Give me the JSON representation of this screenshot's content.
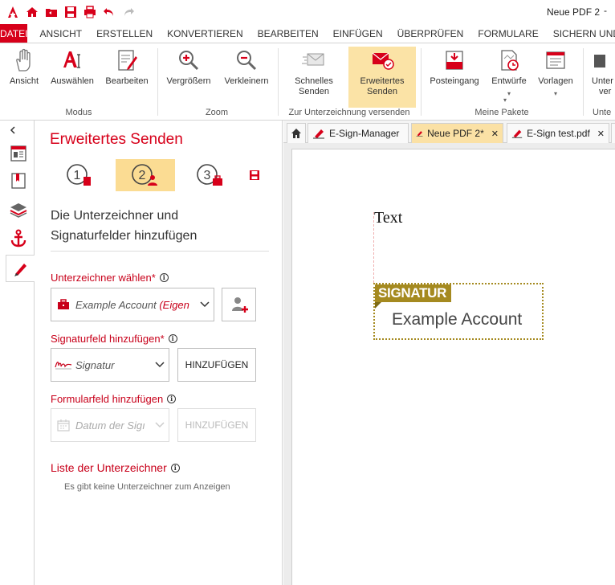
{
  "window": {
    "title": "Neue PDF 2",
    "minimize": "-"
  },
  "ribbon_tabs": [
    "DATEI",
    "ANSICHT",
    "ERSTELLEN",
    "KONVERTIEREN",
    "BEARBEITEN",
    "EINFÜGEN",
    "ÜBERPRÜFEN",
    "FORMULARE",
    "SICHERN UND UNT"
  ],
  "ribbon": {
    "buttons": {
      "ansicht": "Ansicht",
      "auswaehlen": "Auswählen",
      "bearbeiten": "Bearbeiten",
      "vergroessern": "Vergrößern",
      "verkleinern": "Verkleinern",
      "schnelles_senden_1": "Schnelles",
      "schnelles_senden_2": "Senden",
      "erweitertes_senden_1": "Erweitertes",
      "erweitertes_senden_2": "Senden",
      "posteingang": "Posteingang",
      "entwuerfe": "Entwürfe",
      "vorlagen": "Vorlagen",
      "unter_1": "Unter",
      "unter_2": "ver"
    },
    "groups": {
      "modus": "Modus",
      "zoom": "Zoom",
      "zur_unterzeichnung": "Zur Unterzeichnung versenden",
      "meine_pakete": "Meine Pakete",
      "unter": "Unte"
    },
    "dropdown_glyph": "▾"
  },
  "panel": {
    "title": "Erweitertes Senden",
    "steps": [
      "1",
      "2",
      "3"
    ],
    "heading_line1": "Die Unterzeichner und",
    "heading_line2": "Signaturfelder hinzufügen",
    "signer_label": "Unterzeichner wählen",
    "signer_value": "Example Account",
    "signer_value_suffix": "(Eigen",
    "sigfield_label": "Signaturfeld hinzufügen",
    "sigfield_value": "Signatur",
    "add_button": "HINZUFÜGEN",
    "formfield_label": "Formularfeld hinzufügen",
    "formfield_value": "Datum der Sigı",
    "add_button_disabled": "HINZUFÜGEN",
    "signer_list_title": "Liste der Unterzeichner",
    "signer_list_empty": "Es gibt keine Unterzeichner zum Anzeigen",
    "required_mark": "*",
    "info_glyph": "i"
  },
  "doc_tabs": [
    {
      "label": "E-Sign-Manager",
      "closable": false
    },
    {
      "label": "Neue PDF 2*",
      "closable": true
    },
    {
      "label": "E-Sign test.pdf",
      "closable": true
    }
  ],
  "document": {
    "text": "Text",
    "signature_tag": "SIGNATUR",
    "signature_name": "Example Account"
  },
  "colors": {
    "accent": "#d7001a",
    "highlight": "#fbdc93",
    "signature_gold": "#a58a20"
  }
}
